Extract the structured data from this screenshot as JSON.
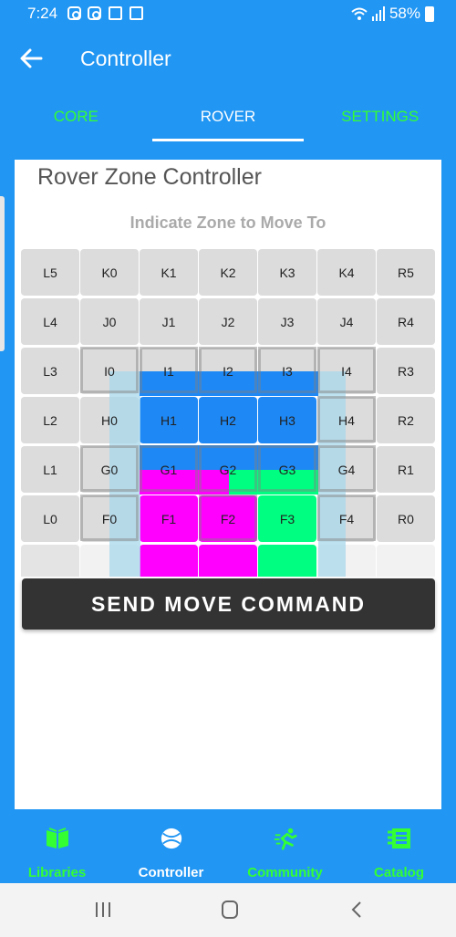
{
  "status_bar": {
    "time": "7:24",
    "battery": "58%"
  },
  "app_bar": {
    "title": "Controller"
  },
  "tabs": [
    {
      "label": "CORE"
    },
    {
      "label": "ROVER"
    },
    {
      "label": "SETTINGS"
    }
  ],
  "card": {
    "title": "Rover Zone Controller",
    "subtitle": "Indicate Zone to Move To",
    "send_label": "SEND MOVE COMMAND"
  },
  "grid": {
    "rows": [
      [
        "L5",
        "K0",
        "K1",
        "K2",
        "K3",
        "K4",
        "R5"
      ],
      [
        "L4",
        "J0",
        "J1",
        "J2",
        "J3",
        "J4",
        "R4"
      ],
      [
        "L3",
        "I0",
        "I1",
        "I2",
        "I3",
        "I4",
        "R3"
      ],
      [
        "L2",
        "H0",
        "H1",
        "H2",
        "H3",
        "H4",
        "R2"
      ],
      [
        "L1",
        "G0",
        "G1",
        "G2",
        "G3",
        "G4",
        "R1"
      ],
      [
        "L0",
        "F0",
        "F1",
        "F2",
        "F3",
        "F4",
        "R0"
      ],
      [
        "",
        "",
        "",
        "",
        "",
        "",
        ""
      ]
    ]
  },
  "bottom_nav": [
    {
      "label": "Libraries",
      "icon": "book-icon"
    },
    {
      "label": "Controller",
      "icon": "ball-icon"
    },
    {
      "label": "Community",
      "icon": "runner-icon"
    },
    {
      "label": "Catalog",
      "icon": "catalog-icon"
    }
  ],
  "colors": {
    "primary": "#2196f3",
    "accent_green": "#33ff33",
    "zone_blue": "#1e88f5",
    "zone_magenta": "#ff00ff",
    "zone_green": "#00ff80",
    "zone_lightblue": "#aad8ec",
    "button_dark": "#333333"
  }
}
